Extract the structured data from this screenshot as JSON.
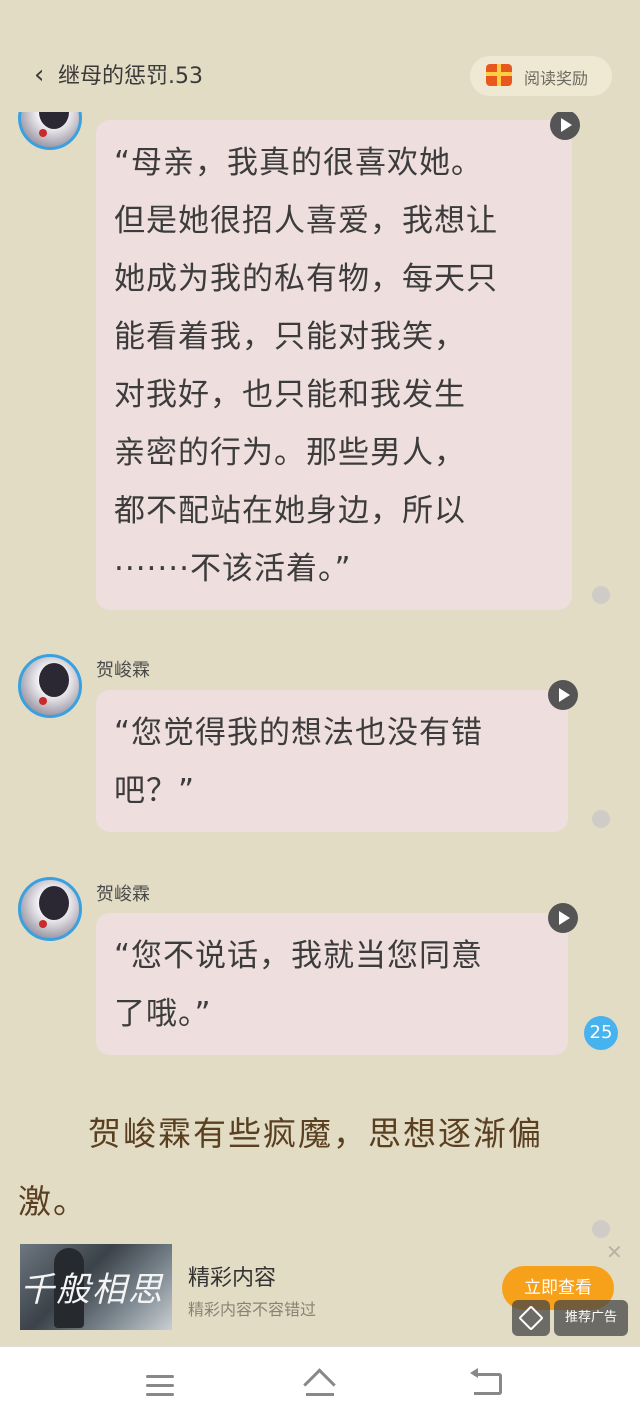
{
  "header": {
    "back_icon": "chevron-left-icon",
    "title": "继母的惩罚.53",
    "reward_icon": "gift-box-icon",
    "reward_label": "阅读奖励"
  },
  "messages": [
    {
      "name": "",
      "lines": [
        "“母亲，我真的很喜欢她。",
        "但是她很招人喜爱，我想让",
        "她成为我的私有物，每天只",
        "能看着我，只能对我笑，",
        "对我好，也只能和我发生",
        "亲密的行为。那些男人，",
        "都不配站在她身边，所以",
        "·······不该活着。”"
      ]
    },
    {
      "name": "贺峻霖",
      "lines": [
        "“您觉得我的想法也没有错",
        "吧？”"
      ]
    },
    {
      "name": "贺峻霖",
      "lines": [
        "“您不说话，我就当您同意",
        "了哦。”"
      ],
      "comment_count": "25"
    }
  ],
  "narration": {
    "line1": "　　贺峻霖有些疯魔，思想逐渐偏",
    "line2": "激。"
  },
  "ad": {
    "image_text": "千般相思",
    "title": "精彩内容",
    "subtitle": "精彩内容不容错过",
    "button_label": "立即查看",
    "close_icon": "close-icon",
    "tag": "推荐广告"
  },
  "colors": {
    "background": "#e3dcc5",
    "bubble": "#efdede",
    "accent_button": "#f7a01a",
    "badge": "#46b3ef",
    "narration_text": "#5a3f21"
  }
}
